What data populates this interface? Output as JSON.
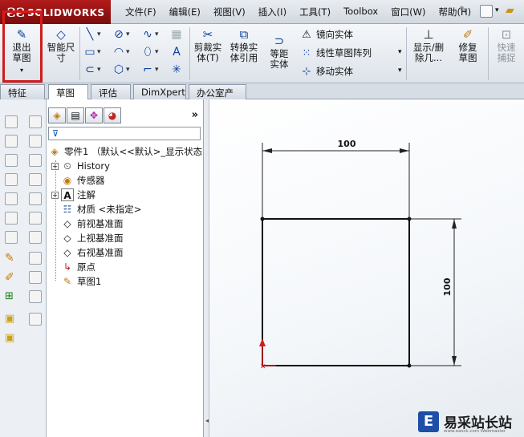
{
  "app": {
    "brand": "SOLIDWORKS",
    "logo_mark": "ƧƧ"
  },
  "menu": [
    "文件(F)",
    "编辑(E)",
    "视图(V)",
    "插入(I)",
    "工具(T)",
    "Toolbox",
    "窗口(W)",
    "帮助(H)"
  ],
  "commands": {
    "exit_sketch": "退出草图",
    "smart_dim": "智能尺寸",
    "trim": "剪裁实体(T)",
    "convert": "转换实体引用",
    "offset": "等距实体",
    "mirror": "镜向实体",
    "linear_pattern": "线性草图阵列",
    "move": "移动实体",
    "show_delete": "显示/删除几...",
    "repair": "修复草图",
    "quick_snap": "快速捕捉"
  },
  "tabs": [
    "特征",
    "草图",
    "评估",
    "DimXpert",
    "办公室产品"
  ],
  "active_tab": "草图",
  "feature_tree": {
    "root": "零件1 （默认<<默认>_显示状态",
    "items": [
      {
        "label": "History",
        "icon": "history-icon",
        "expandable": true
      },
      {
        "label": "传感器",
        "icon": "sensor-icon",
        "expandable": false
      },
      {
        "label": "注解",
        "icon": "annotation-icon",
        "expandable": true
      },
      {
        "label": "材质 <未指定>",
        "icon": "material-icon",
        "expandable": false
      },
      {
        "label": "前视基准面",
        "icon": "plane-icon",
        "expandable": false
      },
      {
        "label": "上视基准面",
        "icon": "plane-icon",
        "expandable": false
      },
      {
        "label": "右视基准面",
        "icon": "plane-icon",
        "expandable": false
      },
      {
        "label": "原点",
        "icon": "origin-icon",
        "expandable": false
      },
      {
        "label": "草图1",
        "icon": "sketch-icon",
        "expandable": false
      }
    ]
  },
  "sketch": {
    "width_dim": "100",
    "height_dim": "100"
  },
  "colors": {
    "highlight_box": "#d11c1c",
    "brand_red": "#b21b1b"
  },
  "watermark": {
    "title": "易采站长站",
    "url": "www.easck.com  Webmaster"
  }
}
